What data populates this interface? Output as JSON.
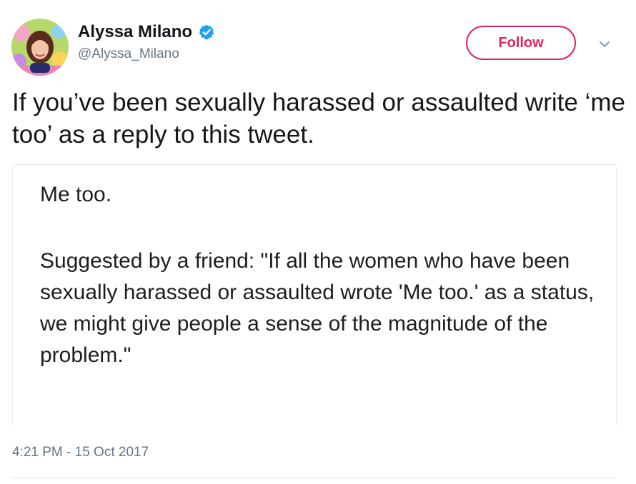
{
  "author": {
    "name": "Alyssa Milano",
    "handle": "@Alyssa_Milano",
    "verified": true
  },
  "actions": {
    "follow_label": "Follow",
    "more_icon": "chevron-down-icon"
  },
  "tweet": {
    "text": "If you’ve been sexually harassed or assaulted write ‘me too’ as a reply to this tweet.",
    "timestamp": "4:21 PM - 15 Oct 2017"
  },
  "media": {
    "line1": "Me too.",
    "paragraph": "Suggested by a friend: \"If all the women who have been sexually harassed or assaulted wrote 'Me too.' as a status, we might give people a sense of the magnitude of the problem.\""
  },
  "colors": {
    "follow_accent": "#e0245e",
    "verified_badge": "#1da1f2",
    "secondary_text": "#657786",
    "primary_text": "#14171a"
  }
}
